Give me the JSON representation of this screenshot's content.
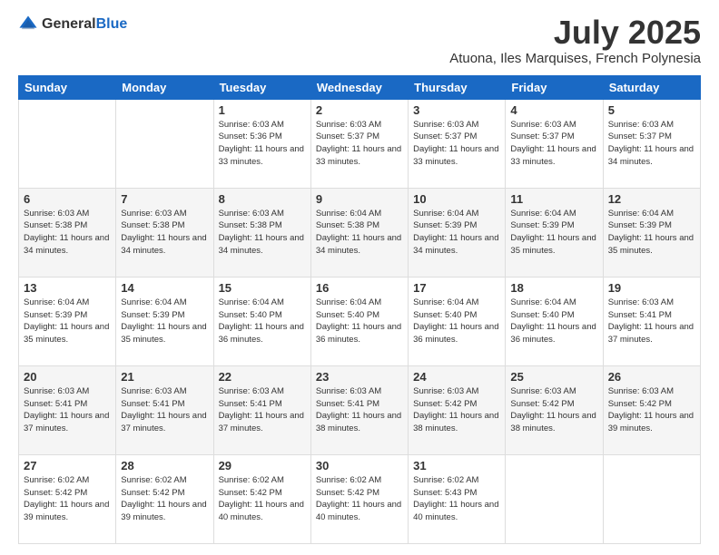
{
  "header": {
    "logo_general": "General",
    "logo_blue": "Blue",
    "month_year": "July 2025",
    "location": "Atuona, Iles Marquises, French Polynesia"
  },
  "weekdays": [
    "Sunday",
    "Monday",
    "Tuesday",
    "Wednesday",
    "Thursday",
    "Friday",
    "Saturday"
  ],
  "weeks": [
    [
      {
        "day": "",
        "sunrise": "",
        "sunset": "",
        "daylight": ""
      },
      {
        "day": "",
        "sunrise": "",
        "sunset": "",
        "daylight": ""
      },
      {
        "day": "1",
        "sunrise": "Sunrise: 6:03 AM",
        "sunset": "Sunset: 5:36 PM",
        "daylight": "Daylight: 11 hours and 33 minutes."
      },
      {
        "day": "2",
        "sunrise": "Sunrise: 6:03 AM",
        "sunset": "Sunset: 5:37 PM",
        "daylight": "Daylight: 11 hours and 33 minutes."
      },
      {
        "day": "3",
        "sunrise": "Sunrise: 6:03 AM",
        "sunset": "Sunset: 5:37 PM",
        "daylight": "Daylight: 11 hours and 33 minutes."
      },
      {
        "day": "4",
        "sunrise": "Sunrise: 6:03 AM",
        "sunset": "Sunset: 5:37 PM",
        "daylight": "Daylight: 11 hours and 33 minutes."
      },
      {
        "day": "5",
        "sunrise": "Sunrise: 6:03 AM",
        "sunset": "Sunset: 5:37 PM",
        "daylight": "Daylight: 11 hours and 34 minutes."
      }
    ],
    [
      {
        "day": "6",
        "sunrise": "Sunrise: 6:03 AM",
        "sunset": "Sunset: 5:38 PM",
        "daylight": "Daylight: 11 hours and 34 minutes."
      },
      {
        "day": "7",
        "sunrise": "Sunrise: 6:03 AM",
        "sunset": "Sunset: 5:38 PM",
        "daylight": "Daylight: 11 hours and 34 minutes."
      },
      {
        "day": "8",
        "sunrise": "Sunrise: 6:03 AM",
        "sunset": "Sunset: 5:38 PM",
        "daylight": "Daylight: 11 hours and 34 minutes."
      },
      {
        "day": "9",
        "sunrise": "Sunrise: 6:04 AM",
        "sunset": "Sunset: 5:38 PM",
        "daylight": "Daylight: 11 hours and 34 minutes."
      },
      {
        "day": "10",
        "sunrise": "Sunrise: 6:04 AM",
        "sunset": "Sunset: 5:39 PM",
        "daylight": "Daylight: 11 hours and 34 minutes."
      },
      {
        "day": "11",
        "sunrise": "Sunrise: 6:04 AM",
        "sunset": "Sunset: 5:39 PM",
        "daylight": "Daylight: 11 hours and 35 minutes."
      },
      {
        "day": "12",
        "sunrise": "Sunrise: 6:04 AM",
        "sunset": "Sunset: 5:39 PM",
        "daylight": "Daylight: 11 hours and 35 minutes."
      }
    ],
    [
      {
        "day": "13",
        "sunrise": "Sunrise: 6:04 AM",
        "sunset": "Sunset: 5:39 PM",
        "daylight": "Daylight: 11 hours and 35 minutes."
      },
      {
        "day": "14",
        "sunrise": "Sunrise: 6:04 AM",
        "sunset": "Sunset: 5:39 PM",
        "daylight": "Daylight: 11 hours and 35 minutes."
      },
      {
        "day": "15",
        "sunrise": "Sunrise: 6:04 AM",
        "sunset": "Sunset: 5:40 PM",
        "daylight": "Daylight: 11 hours and 36 minutes."
      },
      {
        "day": "16",
        "sunrise": "Sunrise: 6:04 AM",
        "sunset": "Sunset: 5:40 PM",
        "daylight": "Daylight: 11 hours and 36 minutes."
      },
      {
        "day": "17",
        "sunrise": "Sunrise: 6:04 AM",
        "sunset": "Sunset: 5:40 PM",
        "daylight": "Daylight: 11 hours and 36 minutes."
      },
      {
        "day": "18",
        "sunrise": "Sunrise: 6:04 AM",
        "sunset": "Sunset: 5:40 PM",
        "daylight": "Daylight: 11 hours and 36 minutes."
      },
      {
        "day": "19",
        "sunrise": "Sunrise: 6:03 AM",
        "sunset": "Sunset: 5:41 PM",
        "daylight": "Daylight: 11 hours and 37 minutes."
      }
    ],
    [
      {
        "day": "20",
        "sunrise": "Sunrise: 6:03 AM",
        "sunset": "Sunset: 5:41 PM",
        "daylight": "Daylight: 11 hours and 37 minutes."
      },
      {
        "day": "21",
        "sunrise": "Sunrise: 6:03 AM",
        "sunset": "Sunset: 5:41 PM",
        "daylight": "Daylight: 11 hours and 37 minutes."
      },
      {
        "day": "22",
        "sunrise": "Sunrise: 6:03 AM",
        "sunset": "Sunset: 5:41 PM",
        "daylight": "Daylight: 11 hours and 37 minutes."
      },
      {
        "day": "23",
        "sunrise": "Sunrise: 6:03 AM",
        "sunset": "Sunset: 5:41 PM",
        "daylight": "Daylight: 11 hours and 38 minutes."
      },
      {
        "day": "24",
        "sunrise": "Sunrise: 6:03 AM",
        "sunset": "Sunset: 5:42 PM",
        "daylight": "Daylight: 11 hours and 38 minutes."
      },
      {
        "day": "25",
        "sunrise": "Sunrise: 6:03 AM",
        "sunset": "Sunset: 5:42 PM",
        "daylight": "Daylight: 11 hours and 38 minutes."
      },
      {
        "day": "26",
        "sunrise": "Sunrise: 6:03 AM",
        "sunset": "Sunset: 5:42 PM",
        "daylight": "Daylight: 11 hours and 39 minutes."
      }
    ],
    [
      {
        "day": "27",
        "sunrise": "Sunrise: 6:02 AM",
        "sunset": "Sunset: 5:42 PM",
        "daylight": "Daylight: 11 hours and 39 minutes."
      },
      {
        "day": "28",
        "sunrise": "Sunrise: 6:02 AM",
        "sunset": "Sunset: 5:42 PM",
        "daylight": "Daylight: 11 hours and 39 minutes."
      },
      {
        "day": "29",
        "sunrise": "Sunrise: 6:02 AM",
        "sunset": "Sunset: 5:42 PM",
        "daylight": "Daylight: 11 hours and 40 minutes."
      },
      {
        "day": "30",
        "sunrise": "Sunrise: 6:02 AM",
        "sunset": "Sunset: 5:42 PM",
        "daylight": "Daylight: 11 hours and 40 minutes."
      },
      {
        "day": "31",
        "sunrise": "Sunrise: 6:02 AM",
        "sunset": "Sunset: 5:43 PM",
        "daylight": "Daylight: 11 hours and 40 minutes."
      },
      {
        "day": "",
        "sunrise": "",
        "sunset": "",
        "daylight": ""
      },
      {
        "day": "",
        "sunrise": "",
        "sunset": "",
        "daylight": ""
      }
    ]
  ]
}
